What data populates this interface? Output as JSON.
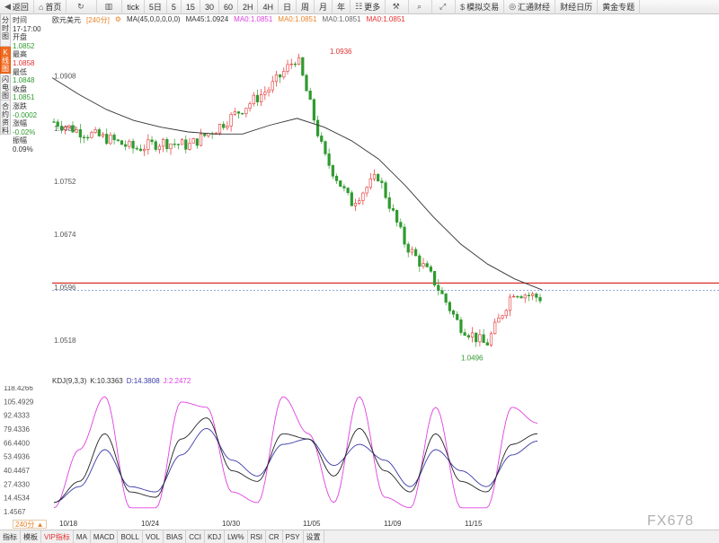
{
  "toolbar": {
    "back": "返回",
    "home": "首页",
    "refresh_icon": "refresh-icon",
    "chart_icon": "bar-chart-icon",
    "tick": "tick",
    "periods": [
      "5日",
      "5",
      "15",
      "30",
      "60",
      "2H",
      "4H",
      "日",
      "周",
      "月",
      "年"
    ],
    "more": "更多",
    "sim": "模拟交易",
    "fxweb": "汇通财经",
    "calendar": "财经日历",
    "gold": "黄金专题"
  },
  "vtabs": [
    "分时图",
    "K线图",
    "闪电图",
    "合约资料"
  ],
  "info": {
    "time_label": "时间",
    "time_value": "17-17:00",
    "open_label": "开盘",
    "open_value": "1.0852",
    "high_label": "最高",
    "high_value": "1.0858",
    "low_label": "最低",
    "low_value": "1.0848",
    "close_label": "收盘",
    "close_value": "1.0851",
    "change_label": "涨跌",
    "change_value": "-0.0002",
    "pct_label": "涨幅",
    "pct_value": "-0.02%",
    "amp_label": "振幅",
    "amp_value": "0.09%"
  },
  "header": {
    "symbol": "欧元美元",
    "period": "[240分]",
    "ma_title": "MA(45,0,0,0,0,0)",
    "ma45": "MA45:1.0924",
    "ma0a": "MA0:1.0851",
    "ma0b": "MA0:1.0851",
    "ma0c": "MA0:1.0851",
    "ma0d": "MA0:1.0851"
  },
  "kdj": {
    "title": "KDJ(9,3,3)",
    "k": "K:10.3363",
    "d": "D:14.3808",
    "j": "J:2.2472"
  },
  "price_axis": [
    "1.0908",
    "1.0830",
    "1.0752",
    "1.0674",
    "1.0596",
    "1.0518"
  ],
  "kdj_axis": [
    "118.4266",
    "105.4929",
    "92.4333",
    "79.4336",
    "66.4400",
    "53.4936",
    "40.4467",
    "27.4330",
    "14.4534",
    "1.4567"
  ],
  "annotations": {
    "high": "1.0936",
    "low": "1.0496"
  },
  "dates": [
    "10/18",
    "10/24",
    "10/30",
    "11/05",
    "11/09",
    "11/15"
  ],
  "period_tag": "240分",
  "bottom_tabs": [
    "指标",
    "模板",
    "VIP指标",
    "MA",
    "MACD",
    "BOLL",
    "VOL",
    "BIAS",
    "CCI",
    "KDJ",
    "LW%",
    "RSI",
    "CR",
    "PSY",
    "设置"
  ],
  "watermark": "FX678",
  "colors": {
    "up": "#e33030",
    "down": "#2f9a2f",
    "ma": "#333333",
    "ref_line": "#d9302c",
    "k": "#222222",
    "d": "#3a3aa8",
    "j": "#e040e0"
  },
  "chart_data": {
    "type": "candlestick",
    "symbol": "欧元美元",
    "ylim": [
      1.047,
      1.098
    ],
    "reference_line": 1.0602,
    "last_close": 1.0851,
    "high_annotation": 1.0936,
    "low_annotation": 1.0496,
    "ma45_points": [
      1.0905,
      1.088,
      1.0858,
      1.0842,
      1.0832,
      1.0825,
      1.0822,
      1.0822,
      1.0835,
      1.0845,
      1.0832,
      1.0812,
      1.0785,
      1.0745,
      1.07,
      1.066,
      1.063,
      1.0608,
      1.0592
    ],
    "price_points": [
      1.084,
      1.0825,
      1.0815,
      1.08,
      1.081,
      1.0805,
      1.083,
      1.086,
      1.089,
      1.0936,
      1.079,
      1.072,
      1.076,
      1.066,
      1.061,
      1.054,
      1.051,
      1.059,
      1.058
    ],
    "kdj_ylim": [
      1.4567,
      118.4266
    ],
    "kdj_k": [
      10,
      30,
      75,
      20,
      15,
      70,
      90,
      40,
      30,
      75,
      70,
      35,
      80,
      40,
      20,
      75,
      30,
      20,
      65,
      75
    ],
    "kdj_d": [
      10,
      25,
      60,
      25,
      20,
      55,
      80,
      50,
      35,
      65,
      70,
      45,
      65,
      50,
      25,
      60,
      40,
      25,
      55,
      68
    ],
    "kdj_j": [
      5,
      60,
      110,
      5,
      5,
      105,
      100,
      20,
      10,
      110,
      75,
      10,
      110,
      15,
      5,
      100,
      5,
      5,
      100,
      85
    ]
  }
}
